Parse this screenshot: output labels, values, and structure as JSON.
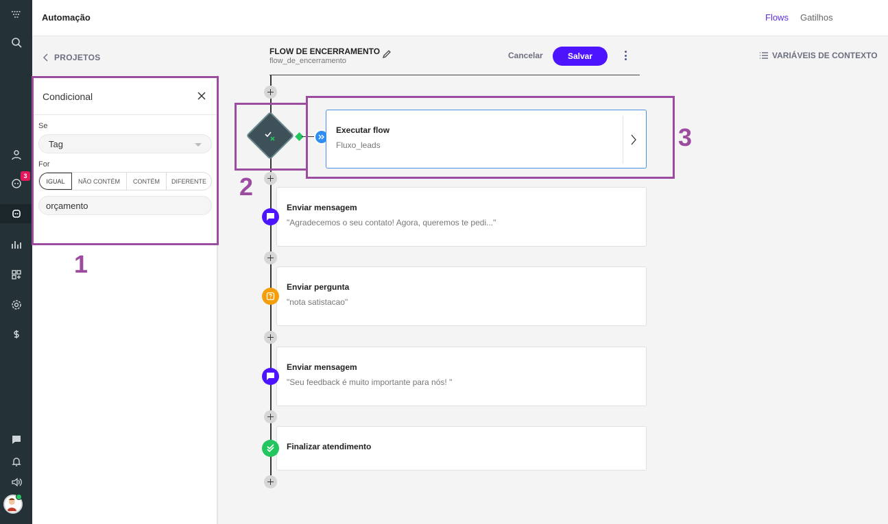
{
  "app": {
    "title": "Automação"
  },
  "top_nav": {
    "items": [
      {
        "label": "Flows",
        "active": true
      },
      {
        "label": "Gatilhos",
        "active": false
      }
    ]
  },
  "rail": {
    "badge_count": "3",
    "icons": [
      "logo-icon",
      "search-icon",
      "contacts-icon",
      "chat-bot-icon",
      "bot-icon",
      "chart-icon",
      "apps-icon",
      "settings-icon",
      "billing-icon",
      "message-icon",
      "bell-icon",
      "sound-icon"
    ]
  },
  "subheader": {
    "back_label": "PROJETOS",
    "flow_title": "FLOW DE ENCERRAMENTO",
    "flow_slug": "flow_de_encerramento",
    "cancel_label": "Cancelar",
    "save_label": "Salvar",
    "context_vars_label": "VARIÁVEIS DE CONTEXTO"
  },
  "panel": {
    "title": "Condicional",
    "if_label": "Se",
    "if_value": "Tag",
    "for_label": "For",
    "operators": [
      "IGUAL",
      "NÃO CONTÉM",
      "CONTÉM",
      "DIFERENTE"
    ],
    "selected_operator": "IGUAL",
    "value": "orçamento"
  },
  "flow": {
    "exec_card": {
      "title": "Executar flow",
      "subtitle": "Fluxo_leads"
    },
    "steps": [
      {
        "title": "Enviar mensagem",
        "subtitle": "\"Agradecemos o seu contato! Agora, queremos te pedi...\"",
        "icon": "message-icon",
        "color": "#4d14ff"
      },
      {
        "title": "Enviar pergunta",
        "subtitle": "\"nota satistacao\"",
        "icon": "question-icon",
        "color": "#f59e0b"
      },
      {
        "title": "Enviar mensagem",
        "subtitle": "\"Seu feedback é muito importante para nós! \"",
        "icon": "message-icon",
        "color": "#4d14ff"
      },
      {
        "title": "Finalizar atendimento",
        "subtitle": "",
        "icon": "check-icon",
        "color": "#22c55e"
      }
    ]
  },
  "annotations": [
    "1",
    "2",
    "3"
  ],
  "colors": {
    "accent": "#4d14ff",
    "annotation": "#9b4ca0",
    "rail": "#243238"
  }
}
